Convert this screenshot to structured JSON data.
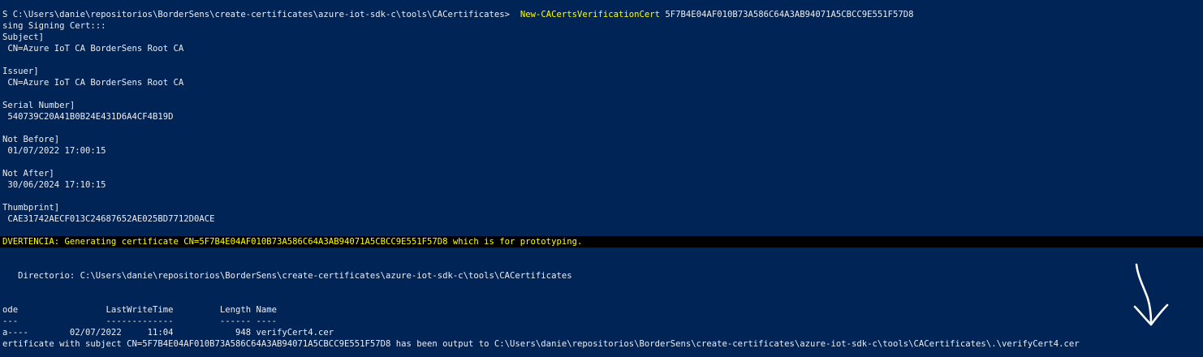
{
  "prompt": {
    "path": "S C:\\Users\\danie\\repositorios\\BorderSens\\create-certificates\\azure-iot-sdk-c\\tools\\CACertificates>",
    "command": "New-CACertsVerificationCert",
    "argument": "5F7B4E04AF010B73A586C64A3AB94071A5CBCC9E551F57D8"
  },
  "output": {
    "signing": "sing Signing Cert:::",
    "subject_label": "Subject]",
    "subject_value": " CN=Azure IoT CA BorderSens Root CA",
    "issuer_label": "Issuer]",
    "issuer_value": " CN=Azure IoT CA BorderSens Root CA",
    "serial_label": "Serial Number]",
    "serial_value": " 540739C20A41B0B24E431D6A4CF4B19D",
    "notbefore_label": "Not Before]",
    "notbefore_value": " 01/07/2022 17:00:15",
    "notafter_label": "Not After]",
    "notafter_value": " 30/06/2024 17:10:15",
    "thumb_label": "Thumbprint]",
    "thumb_value": " CAE31742AECF013C24687652AE025BD7712D0ACE"
  },
  "warning": "DVERTENCIA: Generating certificate CN=5F7B4E04AF010B73A586C64A3AB94071A5CBCC9E551F57D8 which is for prototyping.",
  "directory": "   Directorio: C:\\Users\\danie\\repositorios\\BorderSens\\create-certificates\\azure-iot-sdk-c\\tools\\CACertificates",
  "listing": {
    "header": "ode                 LastWriteTime         Length Name",
    "separator": "---                 -------------         ------ ----",
    "row": "a----        02/07/2022     11:04            948 verifyCert4.cer"
  },
  "final": "ertificate with subject CN=5F7B4E04AF010B73A586C64A3AB94071A5CBCC9E551F57D8 has been output to C:\\Users\\danie\\repositorios\\BorderSens\\create-certificates\\azure-iot-sdk-c\\tools\\CACertificates\\.\\verifyCert4.cer",
  "colors": {
    "background": "#012456",
    "text": "#eeedf0",
    "command": "#ffff00",
    "warning_bg": "#000000",
    "warning_text": "#ffff00",
    "annotation": "#ffffff"
  },
  "annotation_icon": "hand-drawn-down-arrow-icon"
}
